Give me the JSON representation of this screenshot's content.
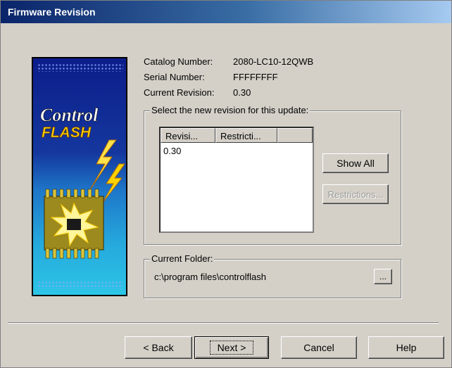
{
  "window": {
    "title": "Firmware Revision"
  },
  "banner": {
    "line1": "Control",
    "line2": "FLASH"
  },
  "info": {
    "catalog_label": "Catalog Number:",
    "catalog_value": "2080-LC10-12QWB",
    "serial_label": "Serial Number:",
    "serial_value": "FFFFFFFF",
    "revision_label": "Current Revision:",
    "revision_value": "0.30"
  },
  "revision_group": {
    "caption": "Select the new revision for this update:",
    "columns": [
      "Revisi...",
      "Restricti..."
    ],
    "rows": [
      {
        "revision": "0.30",
        "restriction": ""
      }
    ],
    "show_all_label": "Show All",
    "restrictions_label": "Restrictions..."
  },
  "folder_group": {
    "caption": "Current Folder:",
    "path": "c:\\program files\\controlflash",
    "browse_label": "..."
  },
  "footer": {
    "back_label": "< Back",
    "next_label": "Next >",
    "cancel_label": "Cancel",
    "help_label": "Help"
  },
  "colors": {
    "title_bar": "#0a246a",
    "dialog_face": "#d4d0c8",
    "banner_blue": "#14379e",
    "banner_cyan": "#2cc6e6",
    "flash_yellow": "#ffd200"
  }
}
